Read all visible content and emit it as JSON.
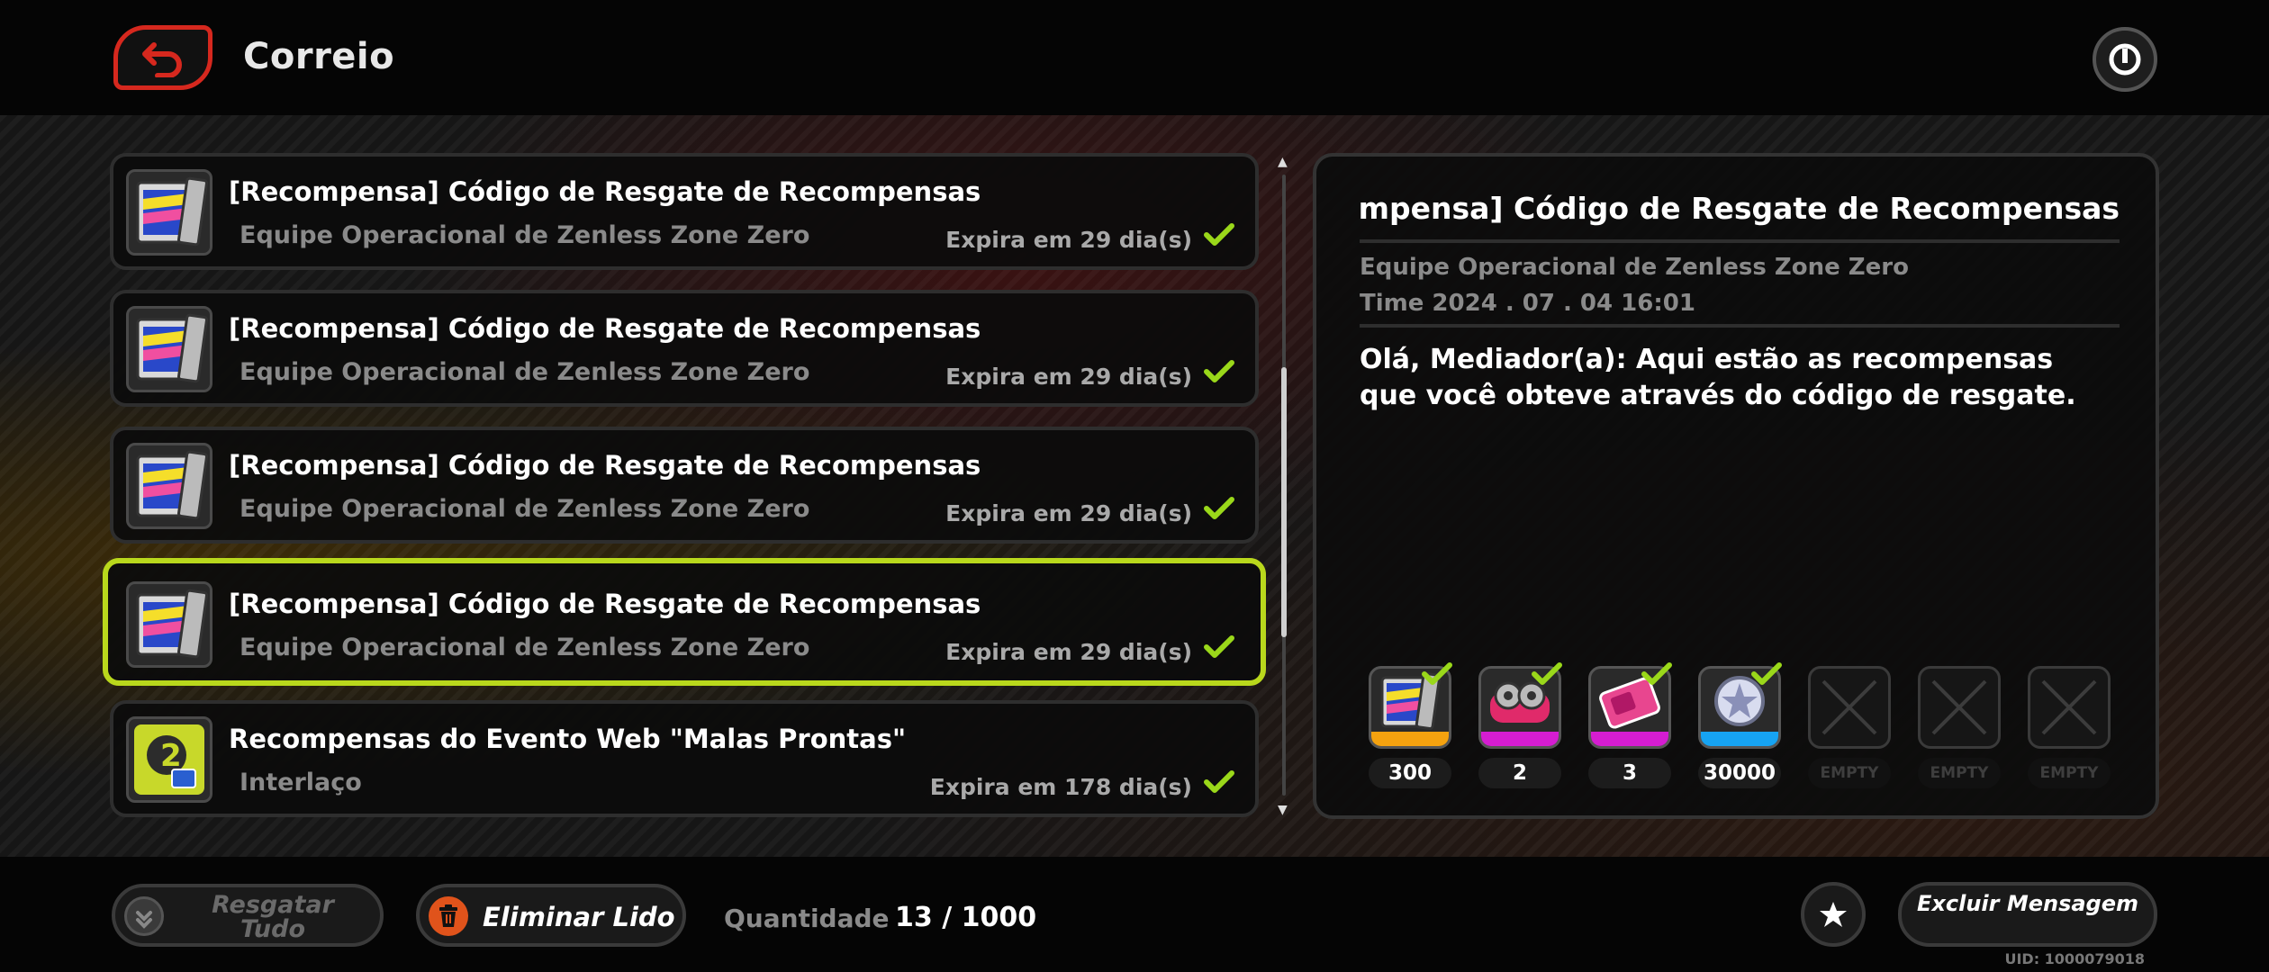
{
  "header": {
    "title": "Correio"
  },
  "mails": [
    {
      "title": "[Recompensa] Código de Resgate de Recompensas",
      "sender": "Equipe Operacional de Zenless Zone Zero",
      "expire": "Expira em 29 dia(s)",
      "thumb_icon": "film-reward-icon",
      "claimed": true,
      "selected": false
    },
    {
      "title": "[Recompensa] Código de Resgate de Recompensas",
      "sender": "Equipe Operacional de Zenless Zone Zero",
      "expire": "Expira em 29 dia(s)",
      "thumb_icon": "film-reward-icon",
      "claimed": true,
      "selected": false
    },
    {
      "title": "[Recompensa] Código de Resgate de Recompensas",
      "sender": "Equipe Operacional de Zenless Zone Zero",
      "expire": "Expira em 29 dia(s)",
      "thumb_icon": "film-reward-icon",
      "claimed": true,
      "selected": false
    },
    {
      "title": "[Recompensa] Código de Resgate de Recompensas",
      "sender": "Equipe Operacional de Zenless Zone Zero",
      "expire": "Expira em 29 dia(s)",
      "thumb_icon": "film-reward-icon",
      "claimed": true,
      "selected": true
    },
    {
      "title": "Recompensas do Evento Web \"Malas Prontas\"",
      "sender": "Interlaço",
      "expire": "Expira em 178 dia(s)",
      "thumb_icon": "bangboo-reward-icon",
      "claimed": true,
      "selected": false
    }
  ],
  "detail": {
    "title": "[Recompensa] Código de Resgate de Recompensas",
    "sender": "Equipe Operacional de Zenless Zone Zero",
    "time": "Time 2024 . 07 . 04   16:01",
    "body": "Olá, Mediador(a): Aqui estão as recompensas que você obteve através do código de resgate.",
    "rewards": [
      {
        "qty": "300",
        "icon": "film-icon",
        "rarity_color": "#f5a20f",
        "claimed": true
      },
      {
        "qty": "2",
        "icon": "tuning-disc-icon",
        "rarity_color": "#d51dd1",
        "claimed": true
      },
      {
        "qty": "3",
        "icon": "battery-chip-icon",
        "rarity_color": "#d51dd1",
        "claimed": true
      },
      {
        "qty": "30000",
        "icon": "dennies-coin-icon",
        "rarity_color": "#16a3f2",
        "claimed": true
      },
      {
        "qty": "EMPTY",
        "icon": "empty-slot-icon",
        "claimed": false
      },
      {
        "qty": "EMPTY",
        "icon": "empty-slot-icon",
        "claimed": false
      },
      {
        "qty": "EMPTY",
        "icon": "empty-slot-icon",
        "claimed": false
      }
    ]
  },
  "footer": {
    "claim_all": "Resgatar Tudo",
    "delete_read": "Eliminar Lido",
    "quantity_label": "Quantidade",
    "quantity_value": "13 / 1000",
    "delete_message": "Excluir Mensagem",
    "uid": "UID: 1000079018"
  },
  "colors": {
    "selected_border": "#b9d81c",
    "check_green": "#9ad81a",
    "back_red": "#d6281e",
    "delete_orange": "#e0531b"
  }
}
